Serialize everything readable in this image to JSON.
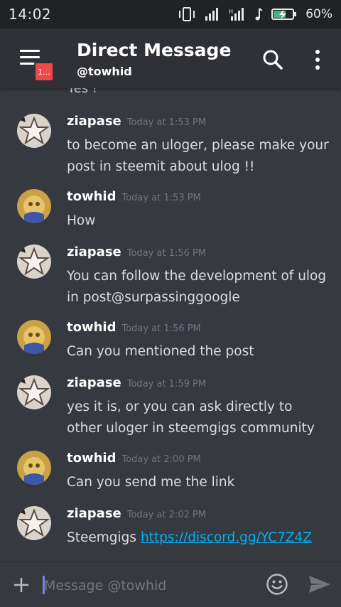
{
  "status_bar": {
    "time": "14:02",
    "battery_percent": "60%",
    "icons": [
      "vibrate-icon",
      "signal-icon",
      "signal-h-icon",
      "music-note-icon",
      "battery-charging-icon"
    ]
  },
  "header": {
    "menu_badge": "1...",
    "title": "Direct Message",
    "subtitle": "@towhid"
  },
  "messages": {
    "partial_text": "Yes !",
    "items": [
      {
        "user": "ziapase",
        "time": "Today at 1:53 PM",
        "text": "to become an uloger, please make your post in steemit about ulog !!"
      },
      {
        "user": "towhid",
        "time": "Today at 1:53 PM",
        "text": "How"
      },
      {
        "user": "ziapase",
        "time": "Today at 1:56 PM",
        "text": "You can follow the development of ulog in post@surpassinggoogle"
      },
      {
        "user": "towhid",
        "time": "Today at 1:56 PM",
        "text": "Can you mentioned the post"
      },
      {
        "user": "ziapase",
        "time": "Today at 1:59 PM",
        "text": "yes it is, or you can ask directly to other uloger in steemgigs community"
      },
      {
        "user": "towhid",
        "time": "Today at 2:00 PM",
        "text": "Can you send me the link"
      },
      {
        "user": "ziapase",
        "time": "Today at 2:02 PM",
        "text": "Steemgigs ",
        "link": "https://discord.gg/YC7Z4Z"
      }
    ]
  },
  "composer": {
    "placeholder": "Message @towhid"
  },
  "colors": {
    "background": "#36393f",
    "header": "#2f3136",
    "statusbar": "#202225",
    "link": "#00b0f4",
    "badge": "#f04747",
    "battery": "#43b581"
  }
}
